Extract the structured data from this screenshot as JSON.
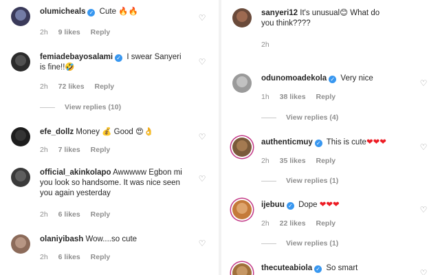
{
  "left": {
    "comments": [
      {
        "username": "olumicheals",
        "verified": true,
        "text": "Cute 🔥🔥",
        "time": "2h",
        "likes": "9 likes",
        "reply": "Reply",
        "avatar_color": "#3a3a5a"
      },
      {
        "username": "femiadebayosalami",
        "verified": true,
        "text": "I swear Sanyeri is fine!!🤣",
        "time": "2h",
        "likes": "72 likes",
        "reply": "Reply",
        "avatar_color": "#2b2b2b",
        "view_replies": "View replies (10)"
      },
      {
        "username": "efe_dollz",
        "verified": false,
        "text": "Money 💰 Good 😍👌",
        "time": "2h",
        "likes": "7 likes",
        "reply": "Reply",
        "avatar_color": "#1d1d1d"
      },
      {
        "username": "official_akinkolapo",
        "verified": false,
        "text": "Awwwww Egbon mi you look so handsome. It was nice seen you again yesterday",
        "time": "2h",
        "likes": "6 likes",
        "reply": "Reply",
        "avatar_color": "#3a3a3a"
      },
      {
        "username": "olaniyibash",
        "verified": false,
        "text": "Wow....so cute",
        "time": "2h",
        "likes": "6 likes",
        "reply": "Reply",
        "avatar_color": "#8c6b5a"
      }
    ]
  },
  "right": {
    "comments": [
      {
        "username": "sanyeri12",
        "verified": false,
        "text": "It's unusual😊 What do you think????",
        "time": "2h",
        "likes": "",
        "reply": "",
        "avatar_color": "#6a4a3a"
      },
      {
        "username": "odunomoadekola",
        "verified": true,
        "text": "Very nice",
        "time": "1h",
        "likes": "38 likes",
        "reply": "Reply",
        "avatar_color": "#9a9a9a",
        "view_replies": "View replies (4)"
      },
      {
        "username": "authenticmuy",
        "verified": true,
        "text": "This is cute",
        "hearts": "❤❤❤",
        "time": "2h",
        "likes": "35 likes",
        "reply": "Reply",
        "avatar_color": "#7a5a3a",
        "view_replies": "View replies (1)"
      },
      {
        "username": "ijebuu",
        "verified": true,
        "text": "Dope",
        "hearts": "❤❤❤",
        "time": "2h",
        "likes": "22 likes",
        "reply": "Reply",
        "avatar_color": "#c47a3a",
        "view_replies": "View replies (1)"
      },
      {
        "username": "thecuteabiola",
        "verified": true,
        "text": "So smart",
        "time": "",
        "likes": "",
        "reply": "",
        "avatar_color": "#a0703a"
      }
    ]
  },
  "icons": {
    "heart": "heart-outline-icon",
    "verified": "verified-badge-icon"
  },
  "colors": {
    "verified": "#3897f0",
    "muted": "#8e8e8e",
    "ring": "#c13584",
    "heart_red": "#ed1c24"
  }
}
